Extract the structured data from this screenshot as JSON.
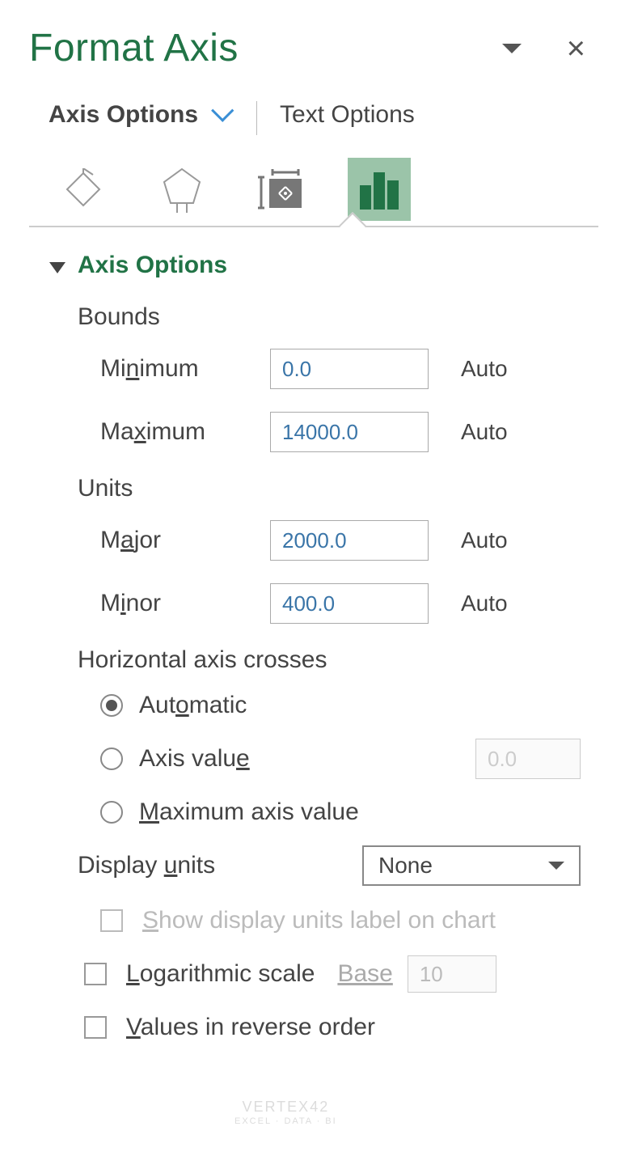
{
  "header": {
    "title": "Format Axis"
  },
  "tabs": {
    "axis": "Axis Options",
    "text": "Text Options"
  },
  "section": {
    "title": "Axis Options"
  },
  "bounds": {
    "label": "Bounds",
    "min_label": "Minimum",
    "min_value": "0.0",
    "min_state": "Auto",
    "max_label": "Maximum",
    "max_value": "14000.0",
    "max_state": "Auto"
  },
  "units": {
    "label": "Units",
    "major_label": "Major",
    "major_value": "2000.0",
    "major_state": "Auto",
    "minor_label": "Minor",
    "minor_value": "400.0",
    "minor_state": "Auto"
  },
  "crosses": {
    "label": "Horizontal axis crosses",
    "auto": "Automatic",
    "axis_value": "Axis value",
    "axis_value_input": "0.0",
    "max": "Maximum axis value"
  },
  "display_units": {
    "label": "Display units",
    "value": "None",
    "show_label": "Show display units label on chart"
  },
  "log": {
    "label": "Logarithmic scale",
    "base_label": "Base",
    "base_value": "10"
  },
  "reverse": {
    "label": "Values in reverse order"
  },
  "watermark": {
    "line1": "VERTEX42",
    "line2": "EXCEL · DATA · BI"
  }
}
